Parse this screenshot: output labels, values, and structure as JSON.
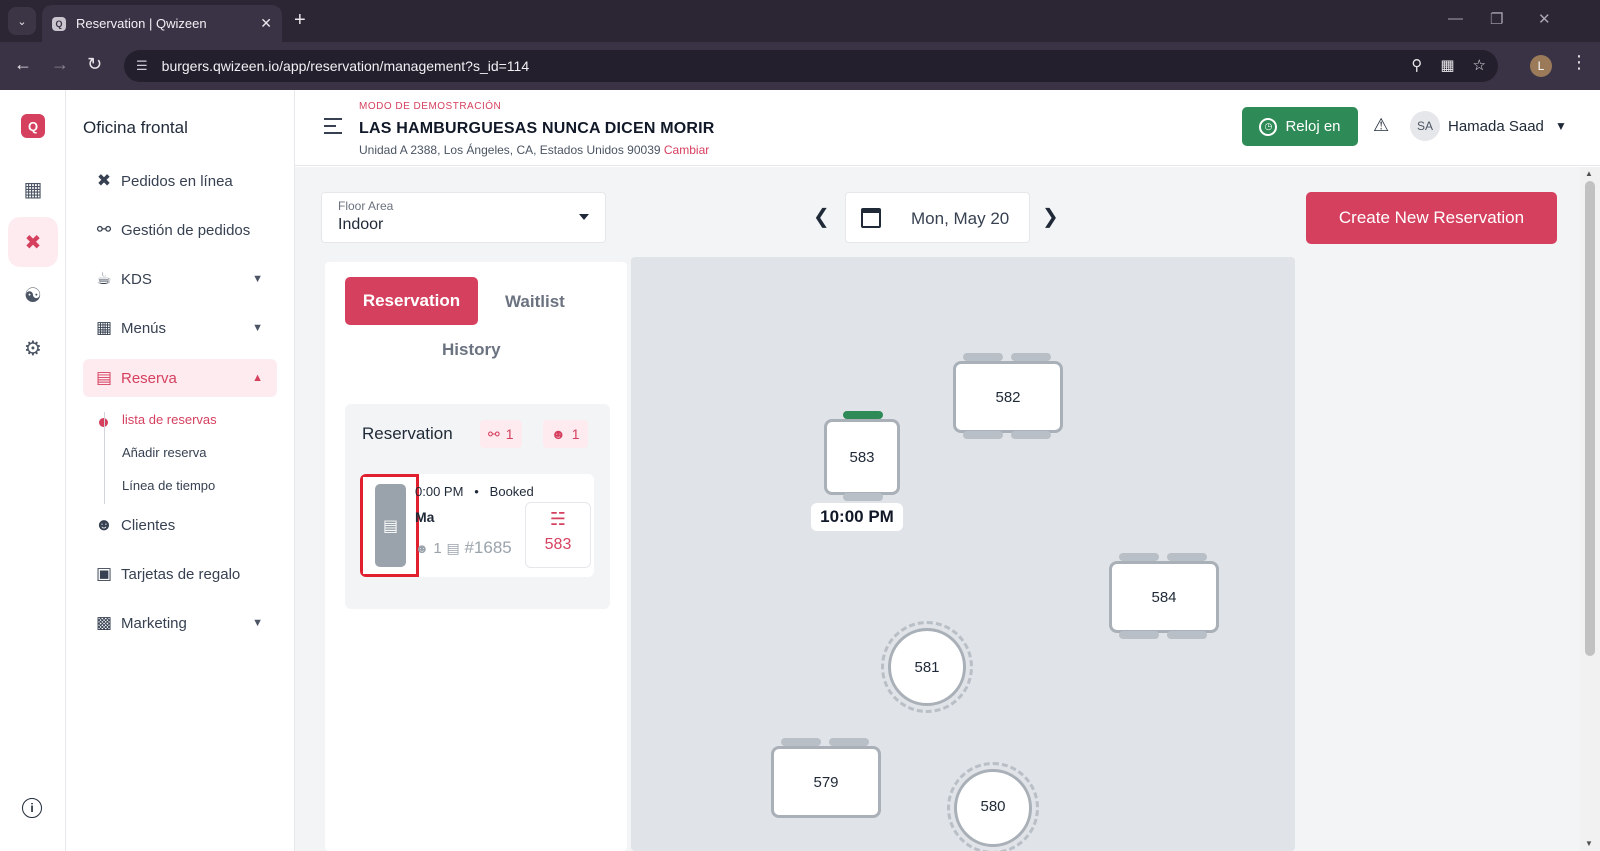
{
  "browser": {
    "tab_title": "Reservation | Qwizeen",
    "url": "burgers.qwizeen.io/app/reservation/management?s_id=114",
    "profile_initial": "L"
  },
  "rail": {
    "logo": "Q"
  },
  "sidebar": {
    "header": "Oficina frontal",
    "items": [
      {
        "label": "Pedidos en línea",
        "icon": "utensils-crossed-icon"
      },
      {
        "label": "Gestión de pedidos",
        "icon": "fork-knife-icon"
      },
      {
        "label": "KDS",
        "icon": "chef-hat-icon"
      },
      {
        "label": "Menús",
        "icon": "grid-icon"
      },
      {
        "label": "Reserva",
        "icon": "floor-plan-icon"
      },
      {
        "label": "Clientes",
        "icon": "users-icon"
      },
      {
        "label": "Tarjetas de regalo",
        "icon": "gift-icon"
      },
      {
        "label": "Marketing",
        "icon": "chart-icon"
      }
    ],
    "sub_items": [
      "lista de reservas",
      "Añadir reserva",
      "Línea de tiempo"
    ]
  },
  "header": {
    "demo": "MODO DE DEMOSTRACIÓN",
    "store": "LAS HAMBURGUESAS NUNCA DICEN MORIR",
    "address": "Unidad A 2388, Los Ángeles, CA, Estados Unidos 90039",
    "change": "Cambiar",
    "clock_in": "Reloj en",
    "avatar": "SA",
    "user": "Hamada Saad"
  },
  "toolbar": {
    "floor_label": "Floor Area",
    "floor_value": "Indoor",
    "date": "Mon, May 20",
    "create": "Create New Reservation"
  },
  "panel": {
    "tabs": {
      "reservation": "Reservation",
      "waitlist": "Waitlist",
      "history": "History"
    },
    "box_title": "Reservation",
    "badge_dining": "1",
    "badge_guests": "1",
    "card": {
      "time": "0:00 PM",
      "status": "Booked",
      "name": "Ma",
      "guests": "1",
      "order": "#1685",
      "table": "583"
    }
  },
  "floorplan": {
    "tables": [
      "582",
      "583",
      "584",
      "581",
      "579",
      "580"
    ],
    "time_tag": "10:00 PM"
  },
  "colors": {
    "accent": "#d6405f",
    "clock": "#2e8b57",
    "highlight": "#e0202e"
  }
}
